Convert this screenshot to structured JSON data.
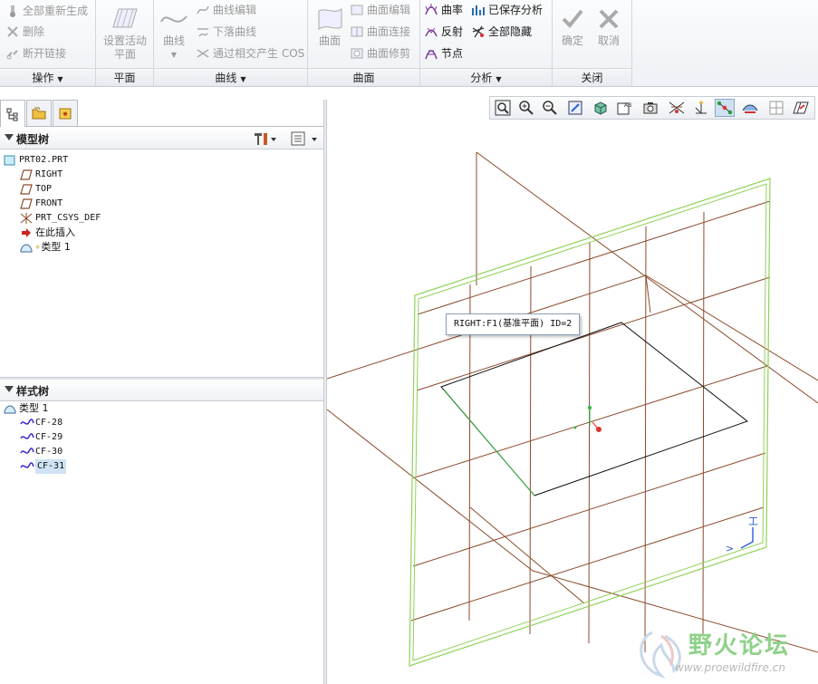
{
  "ribbon": {
    "groups": {
      "operations": {
        "label": "操作",
        "items": [
          "全部重新生成",
          "删除",
          "断开链接"
        ]
      },
      "plane": {
        "label": "平面",
        "button": "设置活动平面"
      },
      "curve": {
        "label": "曲线",
        "button": "曲线",
        "items": [
          "曲线编辑",
          "下落曲线",
          "通过相交产生 COS"
        ]
      },
      "surface": {
        "label": "曲面",
        "button": "曲面",
        "items": [
          "曲面编辑",
          "曲面连接",
          "曲面修剪"
        ]
      },
      "analysis": {
        "label": "分析",
        "items": [
          "曲率",
          "已保存分析",
          "反射",
          "全部隐藏",
          "节点"
        ]
      },
      "close": {
        "label": "关闭",
        "ok": "确定",
        "cancel": "取消"
      }
    }
  },
  "model_tree": {
    "title": "模型树",
    "items": [
      "PRT02.PRT",
      "RIGHT",
      "TOP",
      "FRONT",
      "PRT_CSYS_DEF",
      "在此插入",
      "类型 1"
    ]
  },
  "style_tree": {
    "title": "样式树",
    "root": "类型 1",
    "items": [
      "CF-28",
      "CF-29",
      "CF-30",
      "CF-31"
    ],
    "selected": "CF-31"
  },
  "viewport": {
    "tooltip": "RIGHT:F1(基准平面) ID=2",
    "axis_labels": {
      "x": ">",
      "y": "工"
    }
  },
  "watermark": {
    "title": "野火论坛",
    "url": "www.proewildfire.cn"
  },
  "colors": {
    "datum_plane": "#8b4a2a",
    "active_plane": "#8fd35a",
    "curve": "#111111",
    "axis_green": "#3cb54a",
    "axis_red": "#e03030",
    "csys_blue": "#2a5bd7"
  }
}
